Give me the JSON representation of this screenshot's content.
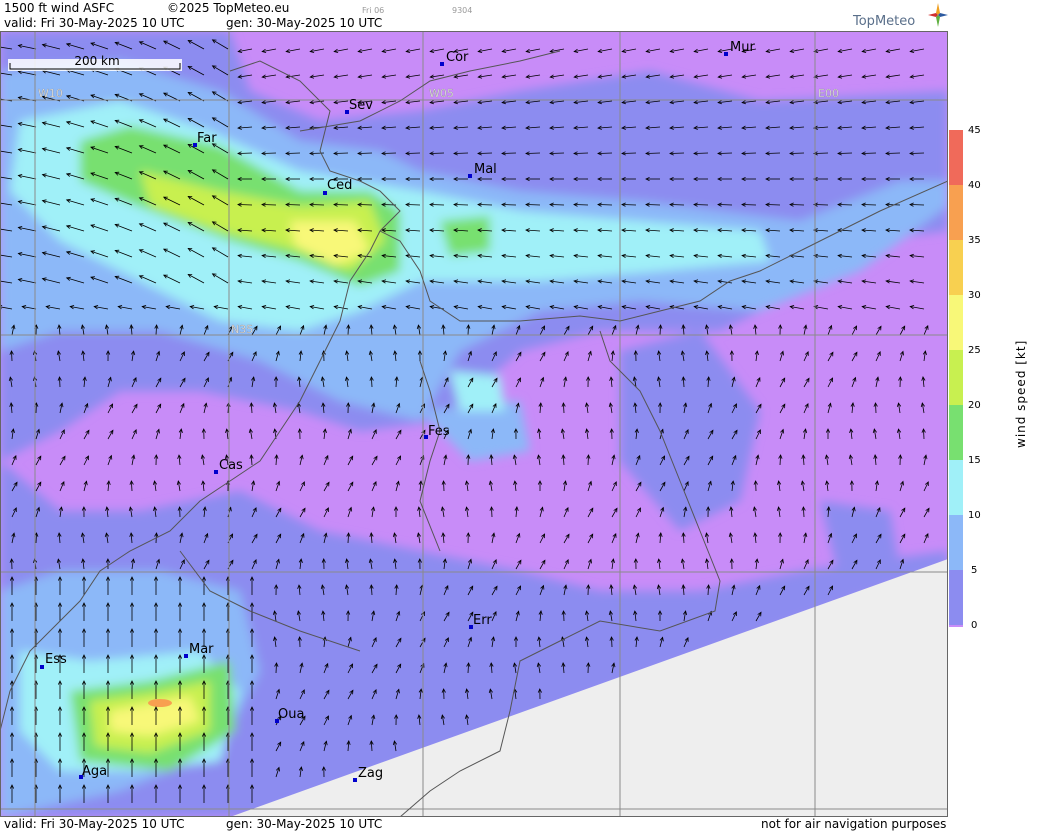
{
  "header": {
    "product": "1500 ft wind ASFC",
    "copyright": "©2025 TopMeteo.eu",
    "small_day": "Fri 06",
    "small_code": "9304",
    "valid": "valid:  Fri  30-May-2025  10 UTC",
    "gen": "gen: 30-May-2025 10 UTC",
    "logo": "TopMeteo"
  },
  "map": {
    "scale_label": "200 km",
    "grid_labels": [
      "W10",
      "W05",
      "E00",
      "N35"
    ],
    "cities": [
      {
        "code": "Cor"
      },
      {
        "code": "Mur"
      },
      {
        "code": "Sev"
      },
      {
        "code": "Far"
      },
      {
        "code": "Ced"
      },
      {
        "code": "Mal"
      },
      {
        "code": "Fes"
      },
      {
        "code": "Cas"
      },
      {
        "code": "Err"
      },
      {
        "code": "Ess"
      },
      {
        "code": "Mar"
      },
      {
        "code": "Oua"
      },
      {
        "code": "Aga"
      },
      {
        "code": "Zag"
      }
    ],
    "colors": {
      "land_calm": "#c88cf8",
      "light": "#8c8cf0",
      "moderate": "#8cb8f8",
      "fresh": "#a0f0f8",
      "strong": "#78e070",
      "very_strong": "#c8f050",
      "gale": "#f8f878",
      "no_data": "#eeeeee"
    }
  },
  "legend": {
    "title": "wind speed [kt]",
    "ticks": [
      "45",
      "40",
      "35",
      "30",
      "25",
      "20",
      "15",
      "10",
      "5",
      "0"
    ],
    "colors": [
      "#f06a5a",
      "#f8a050",
      "#f8d050",
      "#f8f878",
      "#c8f050",
      "#78e070",
      "#a0f0f8",
      "#8cb8f8",
      "#8c8cf0",
      "#c88cf8"
    ]
  },
  "footer": {
    "valid": "valid:  Fri  30-May-2025  10 UTC",
    "gen": "gen: 30-May-2025 10 UTC",
    "note": "not for air navigation purposes"
  }
}
